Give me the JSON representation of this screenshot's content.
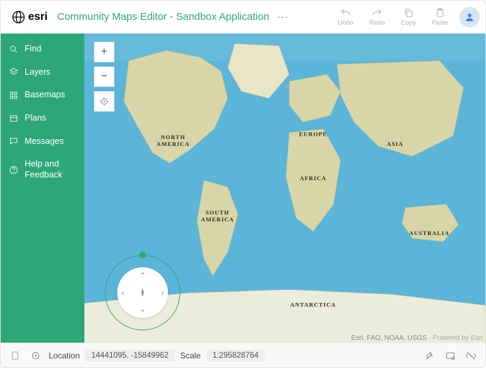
{
  "header": {
    "brand": "esri",
    "title": "Community Maps Editor - Sandbox Application",
    "more": "···",
    "undo": "Undo",
    "redo": "Redo",
    "copy": "Copy",
    "paste": "Paste"
  },
  "sidebar": {
    "find": "Find",
    "layers": "Layers",
    "basemaps": "Basemaps",
    "plans": "Plans",
    "messages": "Messages",
    "help": "Help and Feedback"
  },
  "map": {
    "labels": {
      "north_america": "NORTH AMERICA",
      "south_america": "SOUTH AMERICA",
      "europe": "EUROPE",
      "africa": "AFRICA",
      "asia": "ASIA",
      "australia": "AUSTRALIA",
      "antarctica": "ANTARCTICA"
    },
    "attribution": "Esri, FAO, NOAA, USGS",
    "powered": "Powered by Esri"
  },
  "footer": {
    "location_label": "Location",
    "location_value": "14441095, -15849962",
    "scale_label": "Scale",
    "scale_value": "1:295828764"
  }
}
